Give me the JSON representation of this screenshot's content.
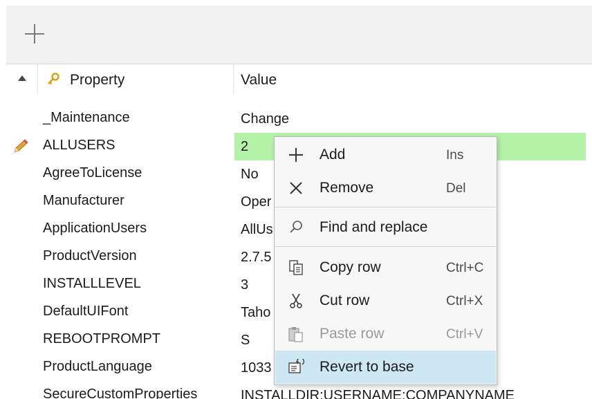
{
  "toolbar": {
    "add_icon": "plus-icon"
  },
  "table": {
    "header": {
      "property": "Property",
      "value": "Value",
      "sort_icon": "sort-asc-icon",
      "key_icon": "key-icon"
    },
    "rows": [
      {
        "property": "_Maintenance",
        "value": "Change"
      },
      {
        "property": "ALLUSERS",
        "value": "2"
      },
      {
        "property": "AgreeToLicense",
        "value": "No"
      },
      {
        "property": "Manufacturer",
        "value": "Oper"
      },
      {
        "property": "ApplicationUsers",
        "value": "AllUs"
      },
      {
        "property": "ProductVersion",
        "value": "2.7.5"
      },
      {
        "property": "INSTALLLEVEL",
        "value": "3"
      },
      {
        "property": "DefaultUIFont",
        "value": "Taho"
      },
      {
        "property": "REBOOTPROMPT",
        "value": "S"
      },
      {
        "property": "ProductLanguage",
        "value": "1033"
      },
      {
        "property": "SecureCustomProperties",
        "value": "INSTALLDIR;USERNAME;COMPANYNAME"
      }
    ],
    "selected_row_color": "#b4f2a8"
  },
  "context_menu": {
    "items": [
      {
        "label": "Add",
        "shortcut": "Ins",
        "icon": "plus-icon"
      },
      {
        "label": "Remove",
        "shortcut": "Del",
        "icon": "close-icon"
      },
      {
        "label": "Find and replace",
        "shortcut": "",
        "icon": "search-icon"
      },
      {
        "label": "Copy row",
        "shortcut": "Ctrl+C",
        "icon": "copy-icon"
      },
      {
        "label": "Cut row",
        "shortcut": "Ctrl+X",
        "icon": "scissors-icon"
      },
      {
        "label": "Paste row",
        "shortcut": "Ctrl+V",
        "icon": "paste-icon",
        "disabled": true
      },
      {
        "label": "Revert to base",
        "shortcut": "",
        "icon": "revert-icon",
        "highlighted": true
      }
    ],
    "highlight_color": "#cde7f5"
  }
}
